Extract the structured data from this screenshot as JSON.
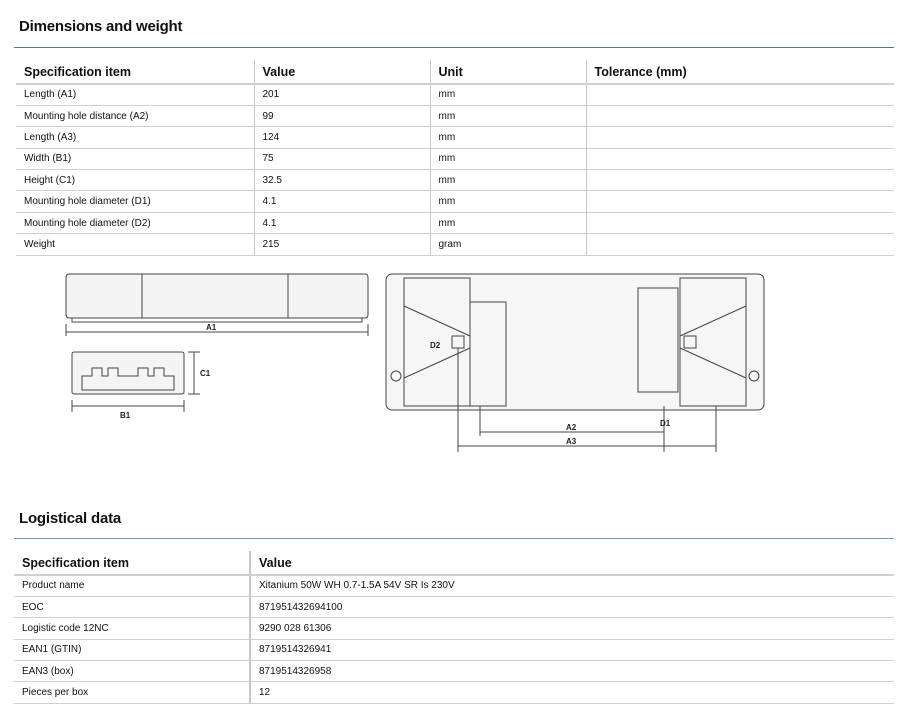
{
  "dimensions": {
    "title": "Dimensions and weight",
    "headers": [
      "Specification item",
      "Value",
      "Unit",
      "Tolerance (mm)"
    ],
    "rows": [
      [
        "Length (A1)",
        "201",
        "mm",
        ""
      ],
      [
        "Mounting hole distance (A2)",
        "99",
        "mm",
        ""
      ],
      [
        "Length (A3)",
        "124",
        "mm",
        ""
      ],
      [
        "Width (B1)",
        "75",
        "mm",
        ""
      ],
      [
        "Height (C1)",
        "32.5",
        "mm",
        ""
      ],
      [
        "Mounting hole diameter (D1)",
        "4.1",
        "mm",
        ""
      ],
      [
        "Mounting hole diameter (D2)",
        "4.1",
        "mm",
        ""
      ],
      [
        "Weight",
        "215",
        "gram",
        ""
      ]
    ],
    "drawing_labels": {
      "a1": "A1",
      "b1": "B1",
      "c1": "C1",
      "d2": "D2",
      "a2": "A2",
      "a3": "A3",
      "d1": "D1"
    }
  },
  "logistics": {
    "title": "Logistical data",
    "headers": [
      "Specification item",
      "Value"
    ],
    "rows": [
      [
        "Product name",
        "Xitanium 50W WH 0.7-1.5A 54V SR Is 230V"
      ],
      [
        "EOC",
        "871951432694100"
      ],
      [
        "Logistic code 12NC",
        "9290 028 61306"
      ],
      [
        "EAN1 (GTIN)",
        "8719514326941"
      ],
      [
        "EAN3 (box)",
        "8719514326958"
      ],
      [
        "Pieces per box",
        "12"
      ]
    ]
  },
  "colors": {
    "rule_top": "#5b6f8f",
    "rule_bottom": "#6f9ad6"
  }
}
